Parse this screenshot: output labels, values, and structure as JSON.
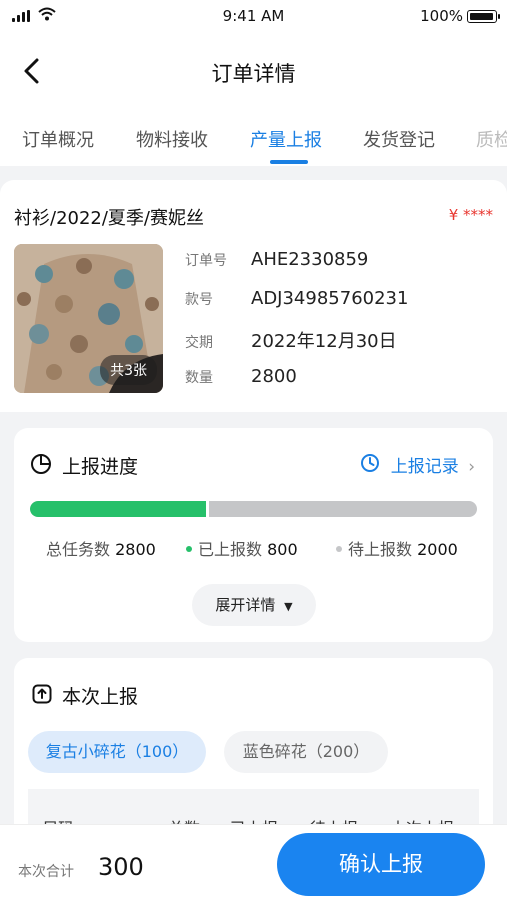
{
  "status_bar": {
    "time": "9:41 AM",
    "battery": "100%"
  },
  "nav": {
    "title": "订单详情"
  },
  "tabs": [
    {
      "label": "订单概况"
    },
    {
      "label": "物料接收"
    },
    {
      "label": "产量上报"
    },
    {
      "label": "发货登记"
    },
    {
      "label": "质检"
    }
  ],
  "order": {
    "title": "衬衫/2022/夏季/赛妮丝",
    "price": "¥ ****",
    "image_badge": "共3张",
    "fields": [
      {
        "label": "订单号",
        "value": "AHE2330859"
      },
      {
        "label": "款号",
        "value": "ADJ34985760231"
      },
      {
        "label": "交期",
        "value": "2022年12月30日"
      },
      {
        "label": "数量",
        "value": "2800"
      }
    ]
  },
  "progress": {
    "title": "上报进度",
    "record_link": "上报记录",
    "completion_fraction": 0.4,
    "total_label": "总任务数",
    "total_value": "2800",
    "reported_label": "已上报数",
    "reported_value": "800",
    "pending_label": "待上报数",
    "pending_value": "2000",
    "expand_label": "展开详情",
    "colors": {
      "reported": "#26c06a",
      "pending": "#c5c6c8"
    }
  },
  "report": {
    "title": "本次上报",
    "chips": [
      {
        "label": "复古小碎花（100）"
      },
      {
        "label": "蓝色碎花（200）"
      }
    ],
    "columns": [
      "尺码",
      "总数",
      "已上报",
      "待上报",
      "本次上报"
    ]
  },
  "footer": {
    "total_label": "本次合计",
    "total_value": "300",
    "confirm_label": "确认上报"
  },
  "accent": "#1a7fe3"
}
